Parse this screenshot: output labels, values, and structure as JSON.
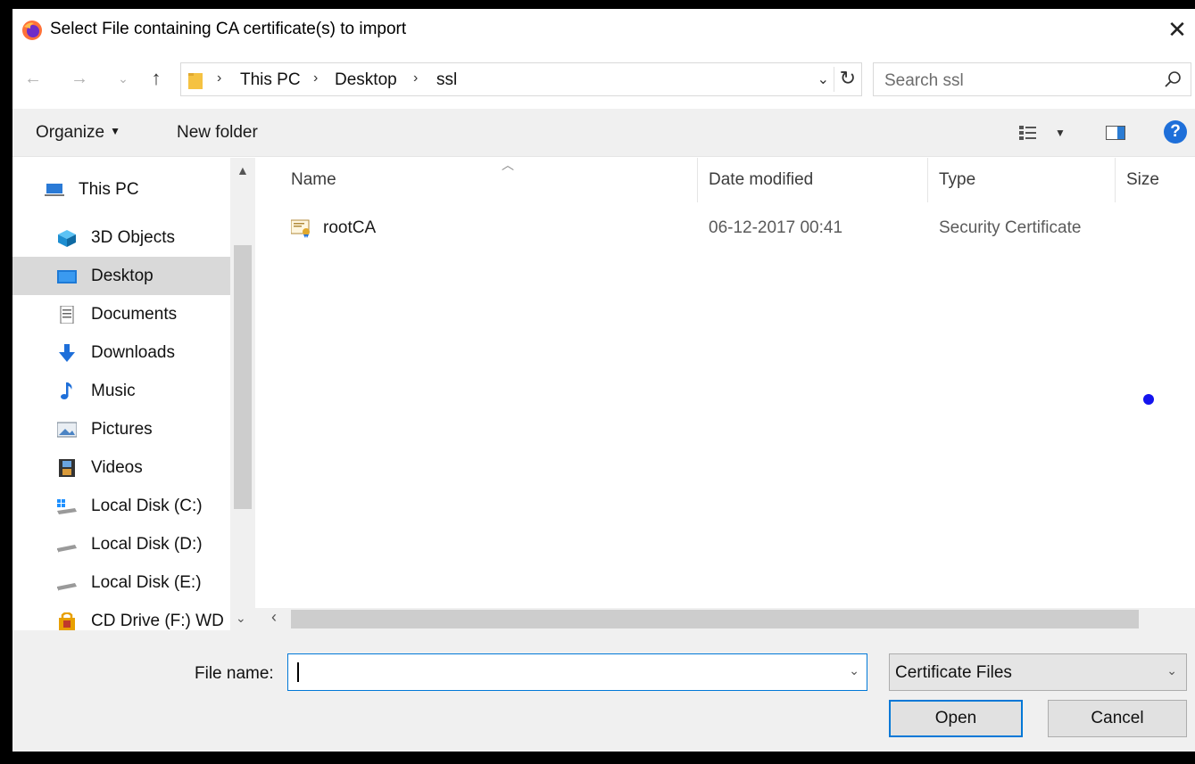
{
  "window": {
    "title": "Select File containing CA certificate(s) to import",
    "close_symbol": "✕",
    "app_icon": "firefox-icon"
  },
  "navigation": {
    "back": "←",
    "forward": "→",
    "recent": "⌄",
    "up": "↑",
    "breadcrumb": [
      "This PC",
      "Desktop",
      "ssl"
    ],
    "crumb_sep": "›",
    "dropdown_symbol": "⌄",
    "refresh_symbol": "↻",
    "search_placeholder": "Search ssl"
  },
  "toolbar": {
    "organize_label": "Organize",
    "new_folder_label": "New folder",
    "help_label": "?"
  },
  "sidebar": {
    "items": [
      {
        "label": "This PC",
        "icon": "computer-icon"
      },
      {
        "label": "3D Objects",
        "icon": "cube-icon"
      },
      {
        "label": "Desktop",
        "icon": "desktop-icon",
        "selected": true
      },
      {
        "label": "Documents",
        "icon": "document-icon"
      },
      {
        "label": "Downloads",
        "icon": "download-arrow-icon"
      },
      {
        "label": "Music",
        "icon": "music-note-icon"
      },
      {
        "label": "Pictures",
        "icon": "pictures-icon"
      },
      {
        "label": "Videos",
        "icon": "film-icon"
      },
      {
        "label": "Local Disk (C:)",
        "icon": "windows-drive-icon"
      },
      {
        "label": "Local Disk (D:)",
        "icon": "drive-icon"
      },
      {
        "label": "Local Disk (E:)",
        "icon": "drive-icon"
      },
      {
        "label": "CD Drive (F:) WD",
        "icon": "cd-drive-lock-icon"
      }
    ]
  },
  "file_list": {
    "columns": [
      "Name",
      "Date modified",
      "Type",
      "Size"
    ],
    "rows": [
      {
        "name": "rootCA",
        "date_modified": "06-12-2017 00:41",
        "type": "Security Certificate",
        "size": ""
      }
    ]
  },
  "footer": {
    "file_name_label": "File name:",
    "file_name_value": "",
    "file_type_value": "Certificate Files",
    "open_label": "Open",
    "cancel_label": "Cancel"
  },
  "colors": {
    "accent": "#0078d7",
    "selected_bg": "#d9d9d9",
    "cursor_dot": "#1414ee"
  }
}
